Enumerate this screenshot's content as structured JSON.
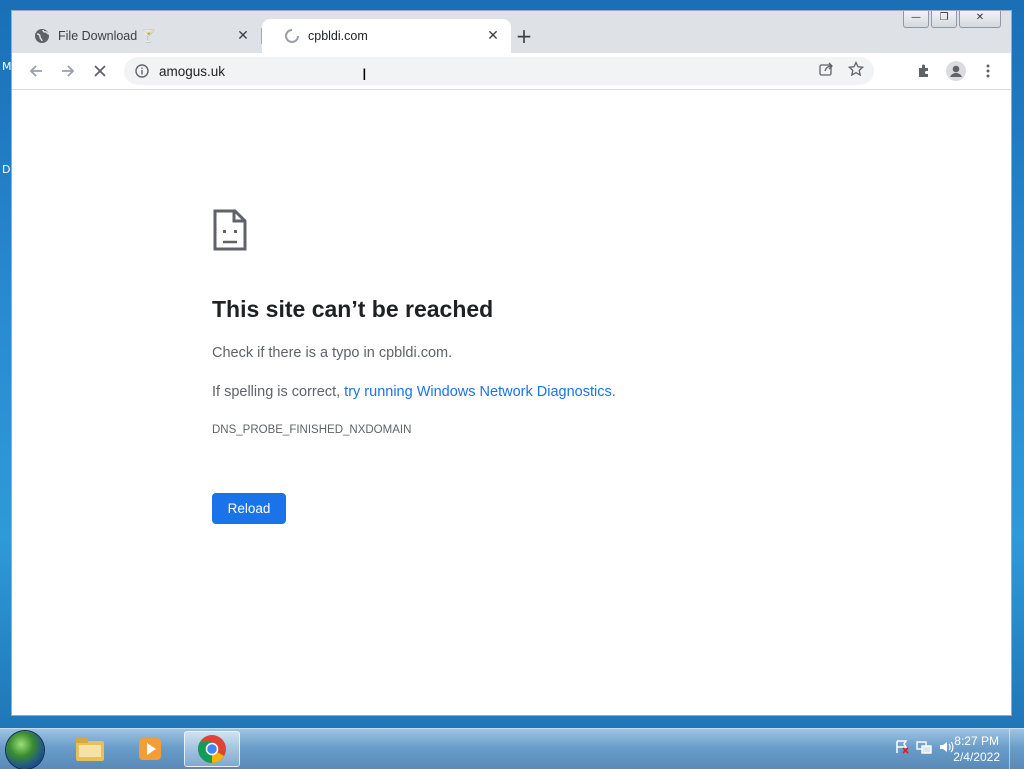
{
  "desktop": {
    "edge_letters": [
      "M",
      "D"
    ]
  },
  "browser": {
    "tabs": [
      {
        "title": "File Download 🍸",
        "favicon": "globe-icon",
        "active": false
      },
      {
        "title": "cpbldi.com",
        "favicon": "loading-spinner-icon",
        "active": true
      }
    ],
    "new_tab_symbol": "+",
    "close_symbol": "✕",
    "window_controls": {
      "minimize": "—",
      "restore": "❐",
      "close": "✕"
    },
    "toolbar": {
      "url": "amogus.uk",
      "icons": [
        "back-arrow-icon",
        "forward-arrow-icon",
        "stop-loading-icon",
        "site-info-icon",
        "share-icon",
        "star-icon",
        "extensions-icon",
        "profile-icon",
        "menu-icon"
      ]
    }
  },
  "error_page": {
    "title": "This site can’t be reached",
    "line1": "Check if there is a typo in cpbldi.com.",
    "line2_prefix": "If spelling is correct, ",
    "line2_link": "try running Windows Network Diagnostics",
    "line2_suffix": ".",
    "error_code": "DNS_PROBE_FINISHED_NXDOMAIN",
    "reload_label": "Reload",
    "accent_color": "#1a73e8"
  },
  "taskbar": {
    "pinned": [
      "file-explorer-icon",
      "media-player-icon",
      "chrome-icon"
    ],
    "active": "chrome-icon",
    "tray_icons": [
      "action-center-icon",
      "network-icon",
      "volume-icon"
    ],
    "clock": {
      "time": "8:27 PM",
      "date": "2/4/2022"
    }
  }
}
